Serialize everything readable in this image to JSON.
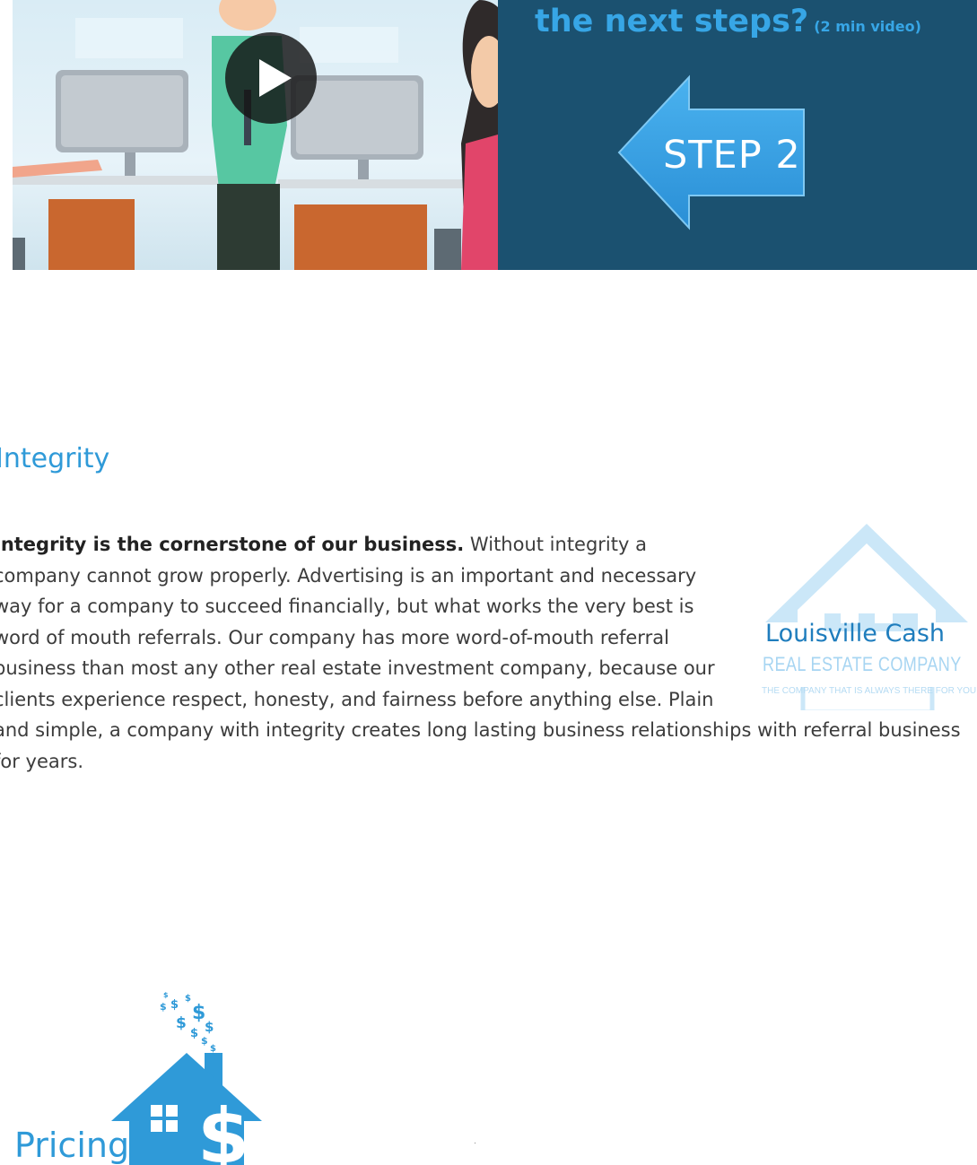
{
  "step_panel": {
    "heading": "the next steps?",
    "heading_note": "(2 min video)",
    "step_label": "STEP 2"
  },
  "integrity": {
    "heading": "Integrity",
    "lead_bold": "Integrity is the cornerstone of our business.",
    "body": "  Without integrity a company cannot grow properly.  Advertising is an important and necessary way for a company to succeed financially, but what works the very best is word of mouth referrals.  Our company has more word-of-mouth referral business than most any other real estate investment company, because our clients experience respect, honesty, and fairness before anything else.  Plain and simple, a company with integrity creates long lasting business relationships with referral business for years."
  },
  "logo": {
    "name": "Louisville Cash",
    "subtitle": "REAL ESTATE COMPANY",
    "tagline": "THE COMPANY THAT IS ALWAYS THERE FOR YOU"
  },
  "pricing": {
    "heading": "Pricing"
  },
  "colors": {
    "accent_blue": "#2f9ad8",
    "panel_navy": "#1b5170",
    "heading_blue": "#37a6e6"
  }
}
